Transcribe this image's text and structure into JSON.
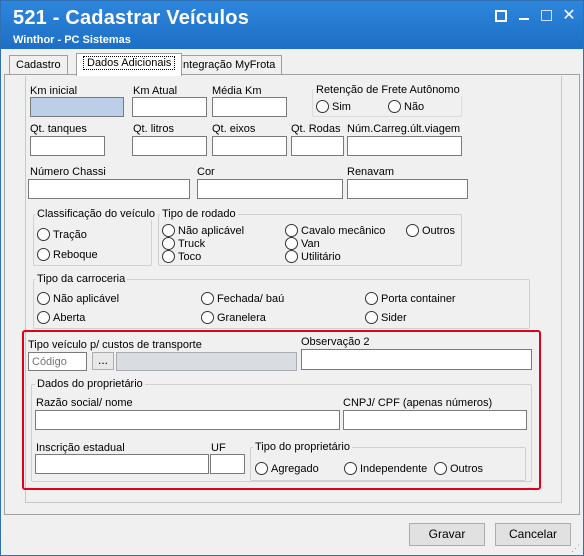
{
  "window": {
    "title": "521 - Cadastrar Veículos",
    "subtitle": "Winthor - PC Sistemas",
    "close_symbol": "✕"
  },
  "tabs": [
    {
      "label": "Cadastro"
    },
    {
      "label": "Dados Adicionais"
    },
    {
      "label": "Integração MyFrota"
    }
  ],
  "fields": {
    "km_inicial": {
      "label": "Km inicial",
      "value": ""
    },
    "km_atual": {
      "label": "Km Atual",
      "value": ""
    },
    "media_km": {
      "label": "Média Km",
      "value": ""
    },
    "qt_tanques": {
      "label": "Qt. tanques",
      "value": ""
    },
    "qt_litros": {
      "label": "Qt. litros",
      "value": ""
    },
    "qt_eixos": {
      "label": "Qt. eixos",
      "value": ""
    },
    "qt_rodas": {
      "label": "Qt. Rodas",
      "value": ""
    },
    "num_carreg": {
      "label": "Núm.Carreg.últ.viagem",
      "value": ""
    },
    "numero_chassi": {
      "label": "Número Chassi",
      "value": ""
    },
    "cor": {
      "label": "Cor",
      "value": ""
    },
    "renavam": {
      "label": "Renavam",
      "value": ""
    }
  },
  "retencao": {
    "title": "Retenção de Frete Autônomo",
    "options": [
      "Sim",
      "Não"
    ]
  },
  "classificacao": {
    "title": "Classificação do veículo",
    "options": [
      "Tração",
      "Reboque"
    ]
  },
  "tipo_rodado": {
    "title": "Tipo de rodado",
    "options": [
      "Não aplicável",
      "Truck",
      "Toco",
      "Cavalo mecânico",
      "Van",
      "Utilitário",
      "Outros"
    ]
  },
  "tipo_carroceria": {
    "title": "Tipo da carroceria",
    "options": [
      "Não aplicável",
      "Aberta",
      "Fechada/ baú",
      "Granelera",
      "Porta container",
      "Sider"
    ]
  },
  "tipo_veiculo": {
    "label": "Tipo veículo p/ custos de transporte",
    "code_placeholder": "Código",
    "button_label": "...",
    "description": ""
  },
  "observacao2": {
    "label": "Observação 2",
    "value": ""
  },
  "proprietario": {
    "title": "Dados do proprietário",
    "razao_social_label": "Razão social/ nome",
    "cnpj_label": "CNPJ/ CPF (apenas números)",
    "inscricao_label": "Inscrição estadual",
    "uf_label": "UF",
    "tipo": {
      "title": "Tipo do proprietário",
      "options": [
        "Agregado",
        "Independente",
        "Outros"
      ]
    }
  },
  "buttons": {
    "gravar": "Gravar",
    "cancelar": "Cancelar"
  }
}
